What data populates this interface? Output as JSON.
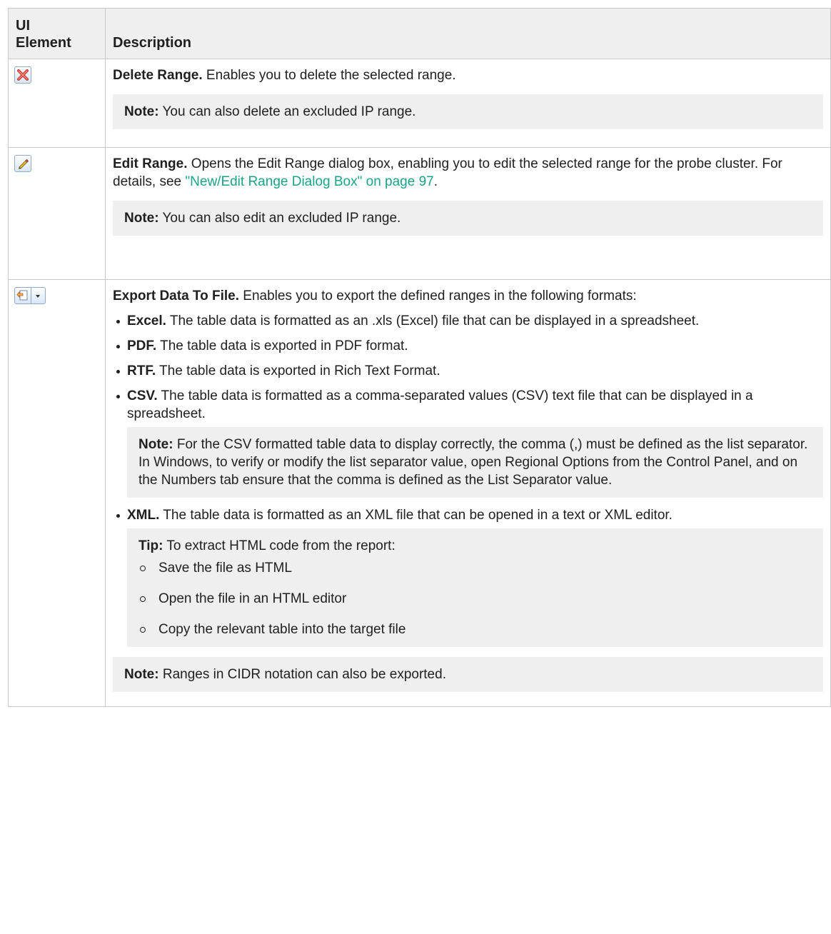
{
  "table": {
    "header": {
      "ui_element": "UI\nElement",
      "description": "Description"
    },
    "delete_row": {
      "icon": "delete-range-icon",
      "title": "Delete Range.",
      "text": " Enables you to delete the selected range.",
      "note_label": "Note:",
      "note_text": " You can also delete an excluded IP range."
    },
    "edit_row": {
      "icon": "edit-range-icon",
      "title": "Edit Range.",
      "text": " Opens the Edit Range dialog box, enabling you to edit the selected range for the probe cluster. For details, see ",
      "link": "\"New/Edit Range Dialog Box\" on page 97",
      "text_end": ".",
      "note_label": "Note:",
      "note_text": " You can also edit an excluded IP range."
    },
    "export_row": {
      "icon": "export-data-icon",
      "title": "Export Data To File.",
      "text": " Enables you to export the defined ranges in the following formats:",
      "formats": [
        {
          "label": "Excel.",
          "text": " The table data is formatted as an .xls (Excel) file that can be displayed in a spreadsheet."
        },
        {
          "label": "PDF.",
          "text": " The table data is exported in PDF format."
        },
        {
          "label": "RTF.",
          "text": " The table data is exported in Rich Text Format."
        },
        {
          "label": "CSV.",
          "text": " The table data is formatted as a comma-separated values (CSV) text file that can be displayed in a spreadsheet."
        }
      ],
      "csv_note_label": "Note:",
      "csv_note_text": " For the CSV formatted table data to display correctly, the comma (,) must be defined as the list separator. In Windows, to verify or modify the list separator value, open Regional Options from the Control Panel, and on the Numbers tab ensure that the comma is defined as the List Separator value.",
      "xml": {
        "label": "XML.",
        "text": " The table data is formatted as an XML file that can be opened in a text or XML editor."
      },
      "tip_label": "Tip:",
      "tip_text": " To extract HTML code from the report:",
      "tip_steps": [
        "Save the file as HTML",
        "Open the file in an HTML editor",
        "Copy the relevant table into the target file"
      ],
      "final_note_label": "Note:",
      "final_note_text": " Ranges in CIDR notation can also be exported."
    }
  },
  "colors": {
    "link": "#1aa386",
    "note_bg": "#efefef",
    "border": "#c8c8c8"
  }
}
